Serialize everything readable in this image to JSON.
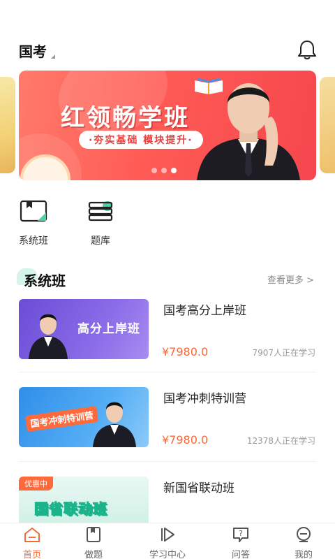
{
  "header": {
    "exam_name": "国考"
  },
  "banner": {
    "title": "红领畅学班",
    "subtitle": "·夯实基础 模块提升·",
    "slide_count": 3,
    "active_slide": 3
  },
  "entries": [
    {
      "label": "系统班",
      "icon": "system-class-icon"
    },
    {
      "label": "题库",
      "icon": "question-bank-icon"
    }
  ],
  "section": {
    "title": "系统班",
    "more": "查看更多 >"
  },
  "courses": [
    {
      "name": "国考高分上岸班",
      "price": "¥7980.0",
      "learners": "7907人正在学习",
      "thumb_text": "高分上岸班",
      "badge": ""
    },
    {
      "name": "国考冲刺特训营",
      "price": "¥7980.0",
      "learners": "12378人正在学习",
      "thumb_text": "国考冲刺特训营",
      "badge": ""
    },
    {
      "name": "新国省联动班",
      "price": "",
      "learners": "",
      "thumb_text": "国省联动班",
      "badge": "优惠中"
    }
  ],
  "tabbar": [
    {
      "label": "首页",
      "icon": "home-icon",
      "active": true
    },
    {
      "label": "做题",
      "icon": "practice-icon",
      "active": false
    },
    {
      "label": "学习中心",
      "icon": "study-center-icon",
      "active": false
    },
    {
      "label": "问答",
      "icon": "qa-icon",
      "active": false
    },
    {
      "label": "我的",
      "icon": "profile-icon",
      "active": false
    }
  ],
  "colors": {
    "accent": "#f26b3a",
    "banner": "#ff5b55",
    "mint": "#4fd1a8"
  }
}
